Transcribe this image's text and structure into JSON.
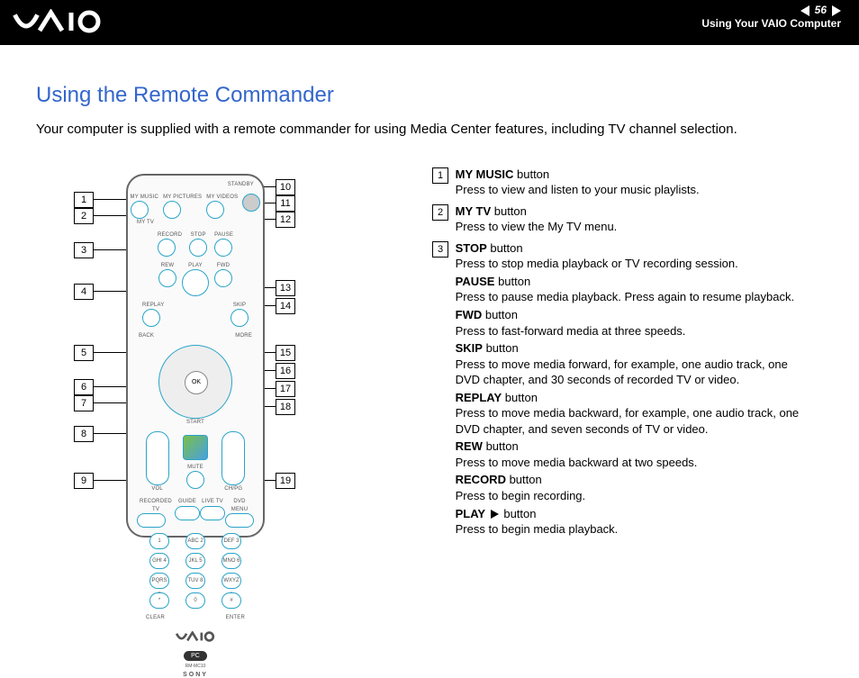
{
  "header": {
    "page_number": "56",
    "breadcrumb": "Using Your VAIO Computer"
  },
  "title": "Using the Remote Commander",
  "intro": "Your computer is supplied with a remote commander for using Media Center features, including TV channel selection.",
  "remote": {
    "top_labels": [
      "MY TV",
      "MY MUSIC",
      "MY PICTURES",
      "MY VIDEOS",
      "STANDBY"
    ],
    "rec_row": [
      "RECORD",
      "STOP",
      "PAUSE"
    ],
    "scan_row": [
      "REW",
      "PLAY",
      "FWD"
    ],
    "nav_row": [
      "REPLAY",
      "SKIP"
    ],
    "side_labels": [
      "BACK",
      "MORE"
    ],
    "ok_label": "OK",
    "start_label": "START",
    "vol_label": "VOL",
    "mute_label": "MUTE",
    "ch_label": "CH/PG",
    "rec_tv": "RECORDED TV",
    "guide": "GUIDE",
    "live_tv": "LIVE TV",
    "dvd_menu": "DVD MENU",
    "keypad": [
      "1",
      "ABC 2",
      "DEF 3",
      "GHI 4",
      "JKL 5",
      "MNO 6",
      "PQRS 7",
      "TUV 8",
      "WXYZ 9",
      "*",
      "0",
      "#"
    ],
    "clear": "CLEAR",
    "enter": "ENTER",
    "pc": "PC",
    "model": "RM-MC10",
    "sony": "SONY"
  },
  "callouts_left": [
    "1",
    "2",
    "3",
    "4",
    "5",
    "6",
    "7",
    "8",
    "9"
  ],
  "callouts_right": [
    "10",
    "11",
    "12",
    "13",
    "14",
    "15",
    "16",
    "17",
    "18",
    "19"
  ],
  "desc": {
    "d1": {
      "title": "MY MUSIC",
      "title_suffix": " button",
      "text": "Press to view and listen to your music playlists."
    },
    "d2": {
      "title": "MY TV",
      "title_suffix": " button",
      "text": "Press to view the My TV menu."
    },
    "d3": {
      "title": "STOP",
      "title_suffix": " button",
      "text": "Press to stop media playback or TV recording session.",
      "sub": [
        {
          "title": "PAUSE",
          "title_suffix": " button",
          "text": "Press to pause media playback. Press again to resume playback."
        },
        {
          "title": "FWD",
          "title_suffix": " button",
          "text": "Press to fast-forward media at three speeds."
        },
        {
          "title": "SKIP",
          "title_suffix": " button",
          "text": "Press to move media forward, for example, one audio track, one DVD chapter, and 30 seconds of recorded TV or video."
        },
        {
          "title": "REPLAY",
          "title_suffix": " button",
          "text": "Press to move media backward, for example, one audio track, one DVD chapter, and seven seconds of TV or video."
        },
        {
          "title": "REW",
          "title_suffix": " button",
          "text": "Press to move media backward at two speeds."
        },
        {
          "title": "RECORD",
          "title_suffix": " button",
          "text": "Press to begin recording."
        },
        {
          "title": "PLAY",
          "title_suffix": " button",
          "play_glyph": true,
          "text": "Press to begin media playback."
        }
      ]
    }
  }
}
